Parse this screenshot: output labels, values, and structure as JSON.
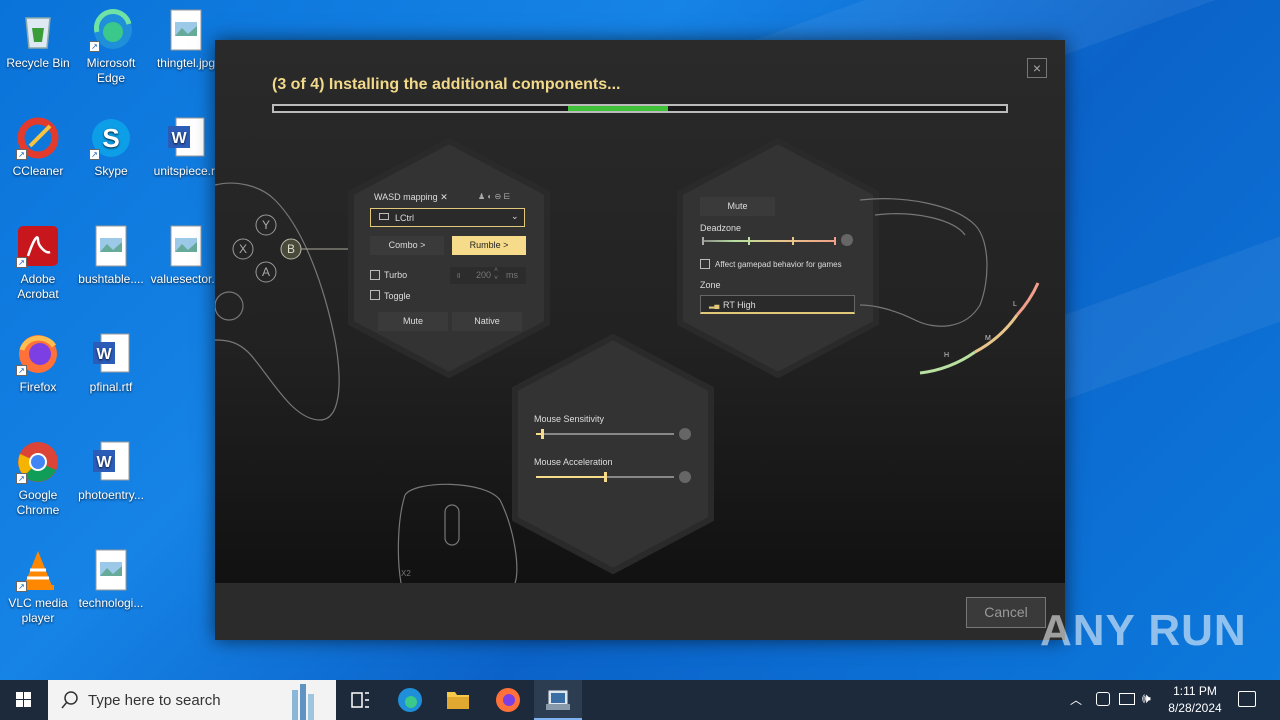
{
  "desktop": {
    "icons": [
      {
        "label": "Recycle Bin"
      },
      {
        "label": "Microsoft Edge"
      },
      {
        "label": "thingtel.jpg"
      },
      {
        "label": "CCleaner"
      },
      {
        "label": "Skype"
      },
      {
        "label": "unitspiece.rt"
      },
      {
        "label": "Adobe Acrobat"
      },
      {
        "label": "bushtable...."
      },
      {
        "label": "valuesector..."
      },
      {
        "label": "Firefox"
      },
      {
        "label": "pfinal.rtf"
      },
      {
        "label": "Google Chrome"
      },
      {
        "label": "photoentry..."
      },
      {
        "label": "VLC media player"
      },
      {
        "label": "technologi..."
      }
    ]
  },
  "installer": {
    "status_title": "(3 of 4) Installing the additional components...",
    "progress_value": 0.47,
    "close_symbol": "×",
    "cancel_label": "Cancel",
    "mapping_panel": {
      "title": "WASD mapping ✕",
      "key_value": "LCtrl",
      "combo_label": "Combo >",
      "rumble_label": "Rumble >",
      "turbo_label": "Turbo",
      "toggle_label": "Toggle",
      "interval_value": "200",
      "interval_unit": "ms",
      "mute_label": "Mute",
      "native_label": "Native"
    },
    "trigger_panel": {
      "mute_label": "Mute",
      "deadzone_label": "Deadzone",
      "affect_label": "Affect gamepad behavior for games",
      "zone_label": "Zone",
      "zone_value": "RT High",
      "arc_labels": [
        "L",
        "M",
        "H"
      ]
    },
    "mouse_panel": {
      "sensitivity_label": "Mouse Sensitivity",
      "sensitivity_value": 0.04,
      "acceleration_label": "Mouse Acceleration",
      "acceleration_value": 0.5
    },
    "controller_buttons": [
      "Y",
      "X",
      "B",
      "A"
    ],
    "mouse_side_label": "X2"
  },
  "taskbar": {
    "search_placeholder": "Type here to search",
    "time": "1:11 PM",
    "date": "8/28/2024"
  },
  "watermark": "ANY RUN",
  "colors": {
    "accent_yellow": "#f2d98a",
    "progress_green": "#3fc13a",
    "desktop_blue": "#0a73d9"
  }
}
